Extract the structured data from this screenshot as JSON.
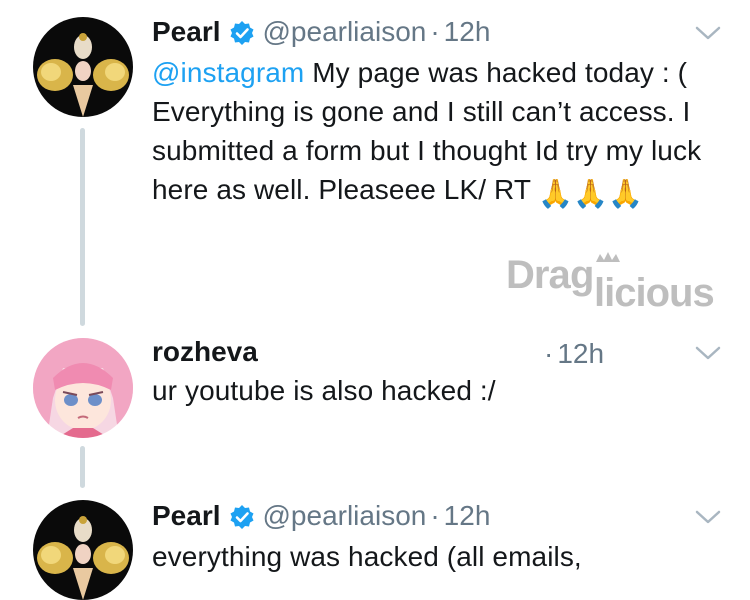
{
  "thread": [
    {
      "name": "Pearl",
      "handle": "@pearliaison",
      "separator": "·",
      "time": "12h",
      "mention": "@instagram",
      "text": " My page was hacked today : ( Everything is gone and I still can’t access. I submitted a form but I thought Id try my luck here as well. Pleaseee LK/ RT ",
      "emoji": "🙏🙏🙏"
    },
    {
      "name": "rozheva",
      "separator": "·",
      "time": "12h",
      "text": "ur youtube is also hacked :/"
    },
    {
      "name": "Pearl",
      "handle": "@pearliaison",
      "separator": "·",
      "time": "12h",
      "text": "everything was hacked (all emails,"
    }
  ],
  "watermark": {
    "text_top": "Drag",
    "text_bottom": "licious"
  },
  "icons": {
    "verified": "verified-badge-icon",
    "caret": "chevron-down-icon",
    "pray": "folded-hands-emoji"
  },
  "colors": {
    "link": "#1da1f2",
    "muted": "#657786",
    "verified": "#1da1f2",
    "thread_line": "#cfd9de"
  }
}
